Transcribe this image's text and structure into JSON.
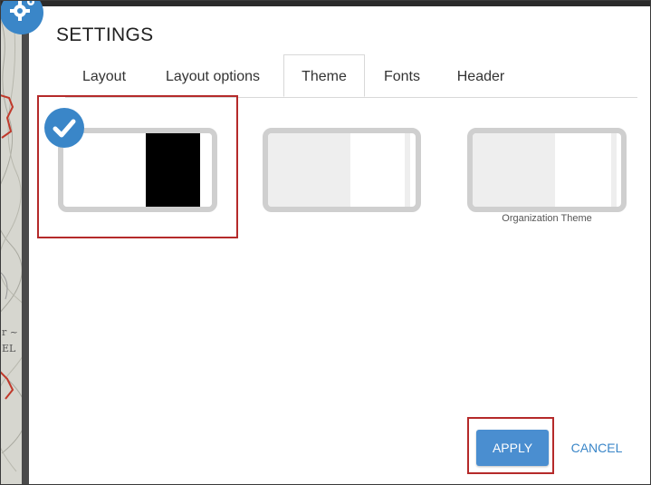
{
  "dialog": {
    "title": "SETTINGS",
    "icon": "gear-icon"
  },
  "tabs": [
    {
      "label": "Layout",
      "active": false
    },
    {
      "label": "Layout options",
      "active": false
    },
    {
      "label": "Theme",
      "active": true
    },
    {
      "label": "Fonts",
      "active": false
    },
    {
      "label": "Header",
      "active": false
    }
  ],
  "themes": [
    {
      "caption": "",
      "selected": true,
      "colors": {
        "main": "#ffffff",
        "accent": "#000000"
      }
    },
    {
      "caption": "",
      "selected": false,
      "colors": {
        "main": "#eeeeee",
        "accent": "#ffffff"
      }
    },
    {
      "caption": "Organization Theme",
      "selected": false,
      "colors": {
        "main": "#eeeeee",
        "accent": "#ffffff"
      }
    }
  ],
  "map_labels": [
    "r ~",
    "EL"
  ],
  "footer": {
    "apply_label": "APPLY",
    "cancel_label": "CANCEL"
  },
  "colors": {
    "accent": "#3a86c8",
    "highlight_outline": "#b52a2a",
    "card_border": "#cfcfcf"
  }
}
